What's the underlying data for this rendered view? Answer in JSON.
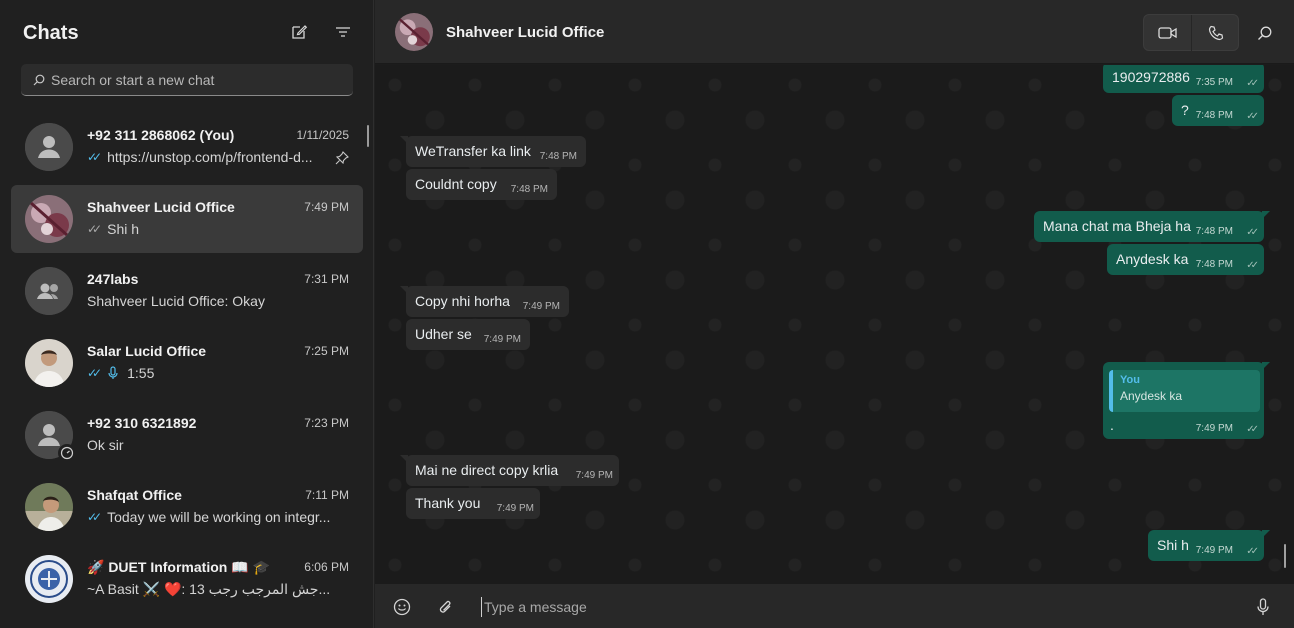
{
  "sidebar": {
    "title": "Chats",
    "search_placeholder": "Search or start a new chat",
    "chats": [
      {
        "name": "+92 311 2868062 (You)",
        "time": "1/11/2025",
        "preview": "https://unstop.com/p/frontend-d...",
        "tick": "blue",
        "pinned": true,
        "avatar": "default"
      },
      {
        "name": "Shahveer Lucid Office",
        "time": "7:49 PM",
        "preview": "Shi h",
        "tick": "grey",
        "active": true,
        "avatar": "photo-pink"
      },
      {
        "name": "247labs",
        "time": "7:31 PM",
        "preview": "Shahveer Lucid Office: Okay",
        "tick": "",
        "avatar": "group"
      },
      {
        "name": "Salar Lucid Office",
        "time": "7:25 PM",
        "preview": "1:55",
        "tick": "blue",
        "voice": true,
        "avatar": "photo-light"
      },
      {
        "name": "+92 310 6321892",
        "time": "7:23 PM",
        "preview": "Ok sir",
        "tick": "",
        "status": true,
        "avatar": "default"
      },
      {
        "name": "Shafqat Office",
        "time": "7:11 PM",
        "preview": "Today we will be working on integr...",
        "tick": "blue",
        "avatar": "photo-green"
      },
      {
        "name": "🚀 DUET Information 📖 🎓",
        "time": "6:06 PM",
        "preview": "~A Basit ⚔️ ❤️: 13 جش المرجب رجب...",
        "tick": "",
        "avatar": "logo"
      }
    ]
  },
  "conversation": {
    "title": "Shahveer Lucid Office",
    "composer_placeholder": "Type a message",
    "messages": [
      {
        "dir": "out",
        "text": "1902972886",
        "time": "7:35 PM"
      },
      {
        "dir": "out",
        "text": "?",
        "time": "7:48 PM"
      },
      {
        "dir": "in",
        "text": "WeTransfer ka link",
        "time": "7:48 PM"
      },
      {
        "dir": "in",
        "text": "Couldnt copy",
        "time": "7:48 PM"
      },
      {
        "dir": "out",
        "text": "Mana chat ma Bheja ha",
        "time": "7:48 PM"
      },
      {
        "dir": "out",
        "text": "Anydesk ka",
        "time": "7:48 PM"
      },
      {
        "dir": "in",
        "text": "Copy nhi horha",
        "time": "7:49 PM"
      },
      {
        "dir": "in",
        "text": "Udher se",
        "time": "7:49 PM"
      },
      {
        "dir": "out",
        "text": ".",
        "time": "7:49 PM",
        "reply_author": "You",
        "reply_text": "Anydesk ka"
      },
      {
        "dir": "in",
        "text": "Mai ne direct copy krlia",
        "time": "7:49 PM"
      },
      {
        "dir": "in",
        "text": "Thank you",
        "time": "7:49 PM"
      },
      {
        "dir": "out",
        "text": "Shi h",
        "time": "7:49 PM"
      }
    ]
  },
  "colors": {
    "incoming_bubble": "#2c2c2c",
    "outgoing_bubble": "#125c4c",
    "read_tick": "#53bdeb"
  }
}
